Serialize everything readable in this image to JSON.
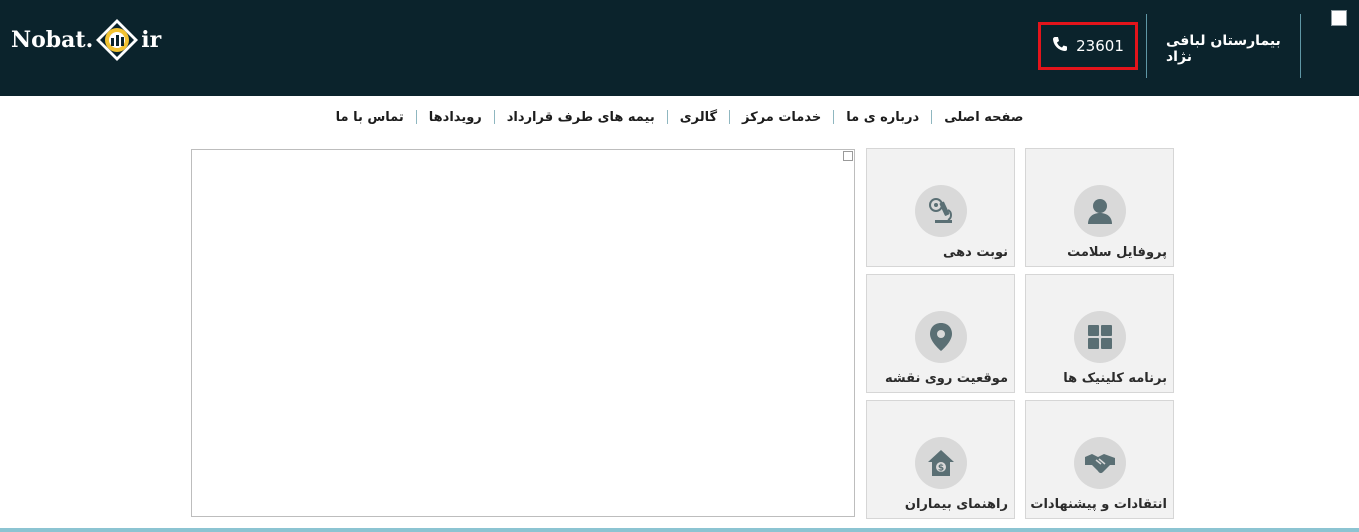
{
  "header": {
    "logo_left": "Nobat.",
    "logo_right": "ir",
    "logo_icon": "nobat-logo-mark",
    "hospital_name": "بیمارستان لبافی نژاد",
    "phone": "23601",
    "phone_icon": "phone-icon",
    "colors": {
      "background": "#0b232c",
      "highlight_border": "#e3141b",
      "divider": "#5f97a6"
    }
  },
  "nav": {
    "items": [
      "صفحه اصلی",
      "درباره ی ما",
      "خدمات مرکز",
      "گالری",
      "بیمه های طرف قرارداد",
      "رویدادها",
      "تماس با ما"
    ]
  },
  "tiles": [
    {
      "label": "پروفایل سلامت",
      "icon": "user-icon"
    },
    {
      "label": "نوبت دهی",
      "icon": "microscope-icon"
    },
    {
      "label": "برنامه کلینیک ها",
      "icon": "grid-icon"
    },
    {
      "label": "موقعیت روی نقشه",
      "icon": "map-pin-icon"
    },
    {
      "label": "انتقادات و پیشنهادات",
      "icon": "handshake-icon"
    },
    {
      "label": "راهنمای بیماران",
      "icon": "house-money-icon"
    }
  ],
  "colors": {
    "tile_bg": "#f2f2f2",
    "icon_circle": "#d9d9d9",
    "icon_fg": "#5a6f74",
    "bottom_line": "#8cc4d2"
  }
}
